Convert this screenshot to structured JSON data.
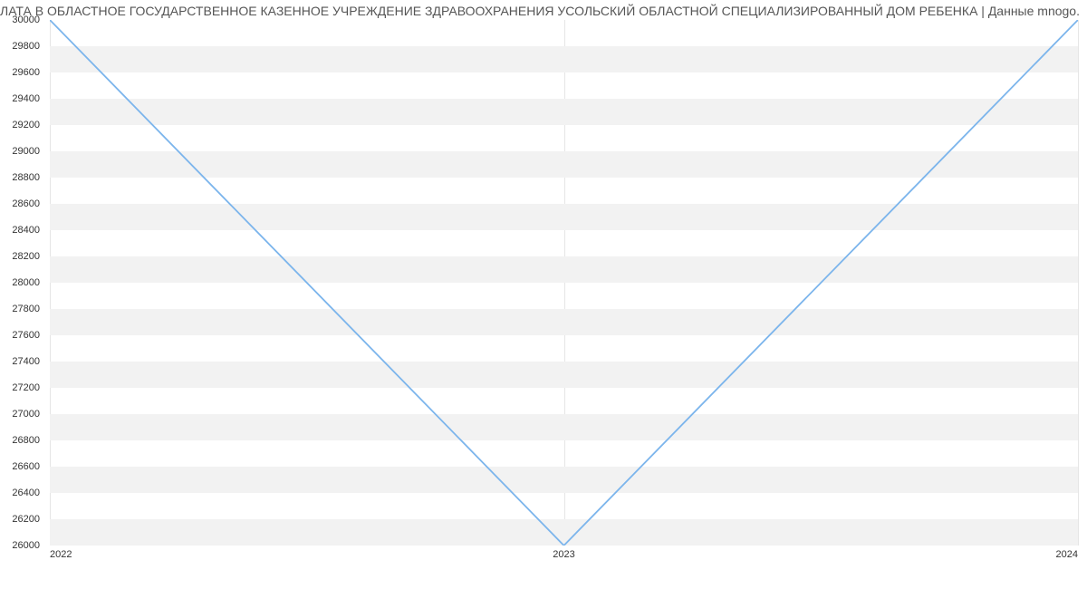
{
  "title": "ЛАТА В ОБЛАСТНОЕ ГОСУДАРСТВЕННОЕ КАЗЕННОЕ УЧРЕЖДЕНИЕ ЗДРАВООХРАНЕНИЯ УСОЛЬСКИЙ ОБЛАСТНОЙ СПЕЦИАЛИЗИРОВАННЫЙ ДОМ РЕБЕНКА | Данные mnogo.",
  "chart_data": {
    "type": "line",
    "x": [
      "2022",
      "2023",
      "2024"
    ],
    "values": [
      30000,
      26000,
      30000
    ],
    "y_ticks": [
      26000,
      26200,
      26400,
      26600,
      26800,
      27000,
      27200,
      27400,
      27600,
      27800,
      28000,
      28200,
      28400,
      28600,
      28800,
      29000,
      29200,
      29400,
      29600,
      29800,
      30000
    ],
    "x_ticks": [
      "2022",
      "2023",
      "2024"
    ],
    "ylim": [
      26000,
      30000
    ],
    "line_color": "#7cb5ec"
  }
}
